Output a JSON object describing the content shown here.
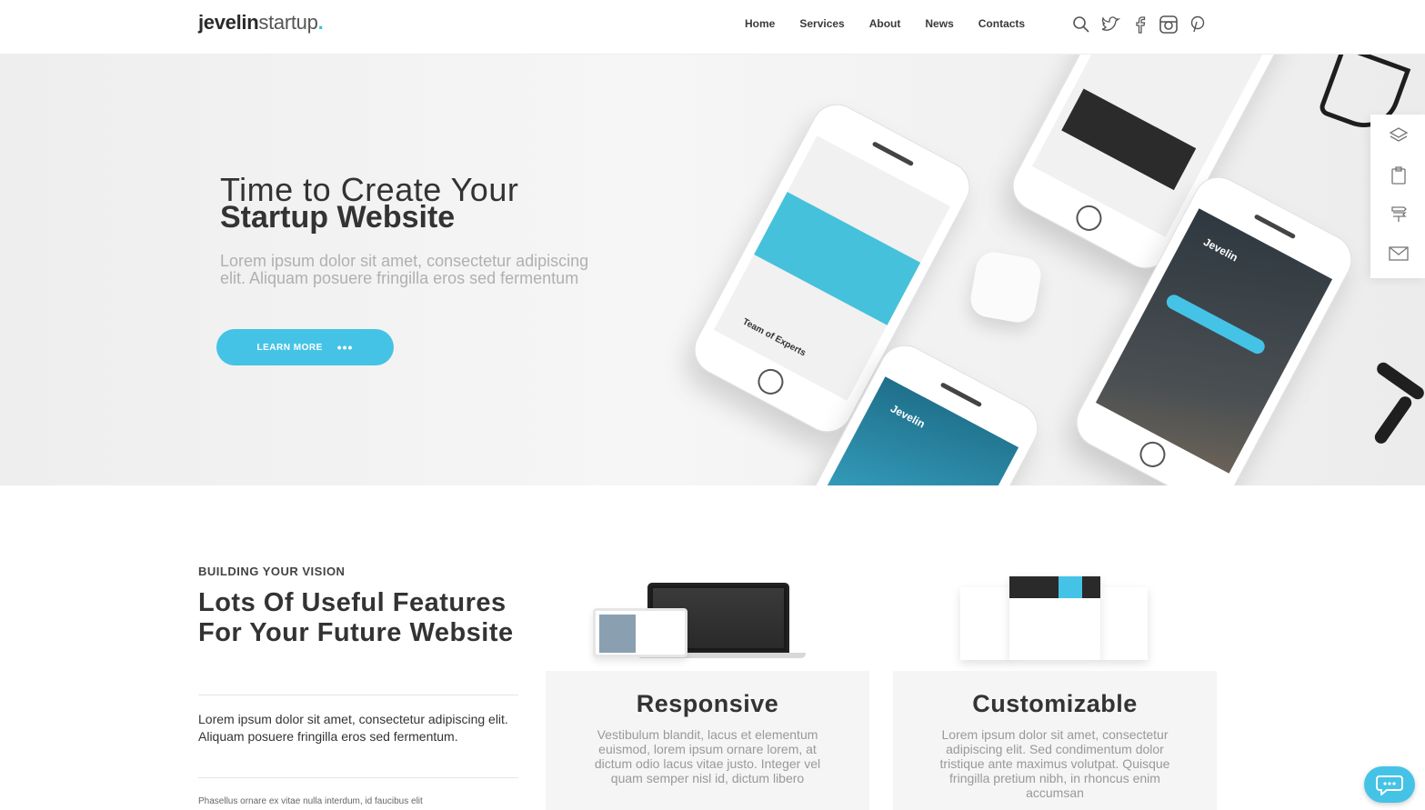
{
  "header": {
    "logo_bold": "jevelin",
    "logo_light": "startup",
    "logo_dot": ".",
    "nav": [
      "Home",
      "Services",
      "About",
      "News",
      "Contacts"
    ],
    "icons": [
      "search-icon",
      "twitter-icon",
      "facebook-icon",
      "instagram-icon",
      "pinterest-icon"
    ]
  },
  "hero": {
    "title_line1": "Time to Create Your",
    "title_line2": "Startup Website",
    "text": "Lorem ipsum dolor sit amet, consectetur adipiscing elit. Aliquam posuere fringilla eros sed fermentum",
    "button_label": "LEARN MORE",
    "button_dots": "•••",
    "phone1_label": "Team of Experts",
    "phone3_brand": "Jevelin",
    "phone4_brand": "Jevelin"
  },
  "side_toolbar": [
    "layers-icon",
    "clipboard-icon",
    "signpost-icon",
    "mail-icon"
  ],
  "features": {
    "eyebrow": "BUILDING YOUR VISION",
    "title": "Lots Of Useful Features For Your Future Website",
    "text": "Lorem ipsum dolor sit amet, consectetur adipiscing elit. Aliquam posuere fringilla eros sed fermentum.",
    "small_text": "Phasellus ornare ex vitae nulla interdum, id faucibus elit",
    "cards": [
      {
        "title": "Responsive",
        "text": "Vestibulum blandit, lacus et elementum euismod, lorem ipsum ornare lorem, at dictum odio lacus vitae justo. Integer vel quam semper nisl id, dictum libero"
      },
      {
        "title": "Customizable",
        "text": "Lorem ipsum dolor sit amet, consectetur adipiscing elit. Sed condimentum dolor tristique ante maximus volutpat. Quisque fringilla pretium nibh, in rhoncus enim accumsan"
      }
    ]
  },
  "colors": {
    "accent": "#45c3e6",
    "text_dark": "#333333",
    "text_muted": "#b0b0b0"
  }
}
